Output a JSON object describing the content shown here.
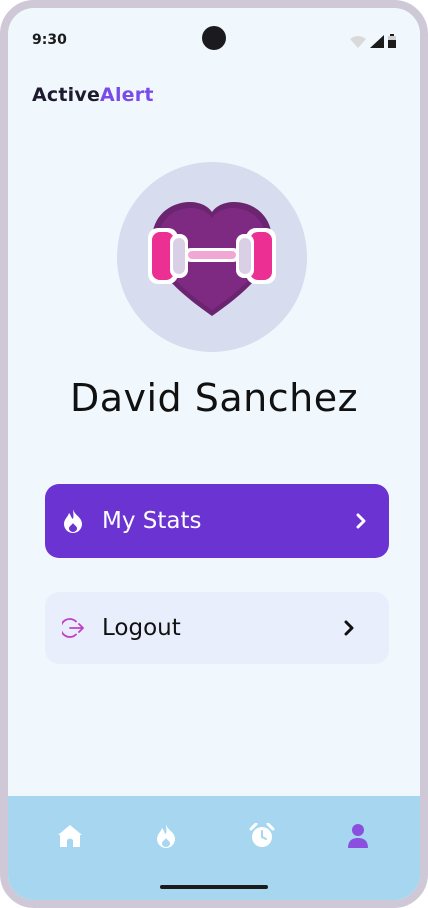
{
  "status_bar": {
    "time": "9:30"
  },
  "brand": {
    "part1": "Active",
    "part2": "Alert"
  },
  "profile": {
    "name": "David  Sanchez"
  },
  "menu": {
    "stats_label": "My Stats",
    "logout_label": "Logout"
  },
  "bottom_nav": {
    "items": [
      {
        "icon": "home-icon",
        "active": false
      },
      {
        "icon": "flame-icon",
        "active": false
      },
      {
        "icon": "alarm-clock-icon",
        "active": false
      },
      {
        "icon": "profile-icon",
        "active": true
      }
    ]
  },
  "colors": {
    "brand_accent": "#7b4bea",
    "stats_button": "#6a33d2",
    "logout_button": "#e8eefb",
    "nav_background": "#a6d6f0",
    "nav_active": "#8b4fe0"
  }
}
